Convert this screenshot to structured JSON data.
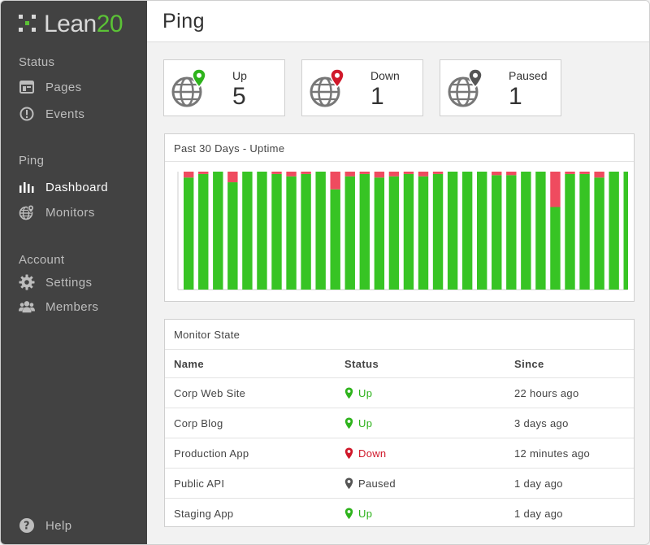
{
  "app": {
    "logo_text": "Lean",
    "logo_accent": "20"
  },
  "sidebar": {
    "sections": [
      {
        "label": "Status",
        "items": [
          {
            "label": "Pages",
            "icon": "pages-icon"
          },
          {
            "label": "Events",
            "icon": "alert-circle-icon"
          }
        ]
      },
      {
        "label": "Ping",
        "items": [
          {
            "label": "Dashboard",
            "icon": "bar-chart-icon",
            "active": true
          },
          {
            "label": "Monitors",
            "icon": "globe-pin-icon"
          }
        ]
      },
      {
        "label": "Account",
        "items": [
          {
            "label": "Settings",
            "icon": "gear-icon"
          },
          {
            "label": "Members",
            "icon": "users-icon"
          }
        ]
      }
    ],
    "help_label": "Help"
  },
  "header": {
    "title": "Ping"
  },
  "stats": [
    {
      "label": "Up",
      "value": "5",
      "pin_color": "#2eb31c"
    },
    {
      "label": "Down",
      "value": "1",
      "pin_color": "#d0182a"
    },
    {
      "label": "Paused",
      "value": "1",
      "pin_color": "#555555"
    }
  ],
  "uptime_panel": {
    "title": "Past 30 Days - Uptime"
  },
  "chart_data": {
    "type": "bar",
    "stacked": true,
    "days": 30,
    "series": [
      {
        "values": [
          95,
          98,
          100,
          91,
          100,
          100,
          98,
          96,
          98,
          100,
          85,
          96,
          98,
          95,
          96,
          98,
          96,
          98,
          100,
          100,
          100,
          97,
          97,
          100,
          100,
          70,
          98,
          98,
          95,
          100,
          100
        ],
        "color": "#37c424"
      },
      {
        "values": [
          5,
          2,
          0,
          9,
          0,
          0,
          2,
          4,
          2,
          0,
          15,
          4,
          2,
          5,
          4,
          2,
          4,
          2,
          0,
          0,
          0,
          3,
          3,
          0,
          0,
          30,
          2,
          2,
          5,
          0,
          0
        ],
        "color": "#ef4b5f"
      }
    ],
    "ylim": [
      0,
      100
    ],
    "grid": false,
    "legend": "none"
  },
  "monitor_panel": {
    "title": "Monitor State",
    "columns": [
      "Name",
      "Status",
      "Since"
    ],
    "rows": [
      {
        "name": "Corp Web Site",
        "status": "Up",
        "since": "22 hours ago",
        "state": "up"
      },
      {
        "name": "Corp Blog",
        "status": "Up",
        "since": "3 days ago",
        "state": "up"
      },
      {
        "name": "Production App",
        "status": "Down",
        "since": "12 minutes ago",
        "state": "down"
      },
      {
        "name": "Public API",
        "status": "Paused",
        "since": "1 day ago",
        "state": "paused"
      },
      {
        "name": "Staging App",
        "status": "Up",
        "since": "1 day ago",
        "state": "up"
      }
    ]
  },
  "colors": {
    "up": "#2eb31c",
    "down": "#d0182a",
    "paused": "#555555",
    "bar_up": "#37c424",
    "bar_down": "#ef4b5f",
    "sidebar_bg": "#424242"
  }
}
